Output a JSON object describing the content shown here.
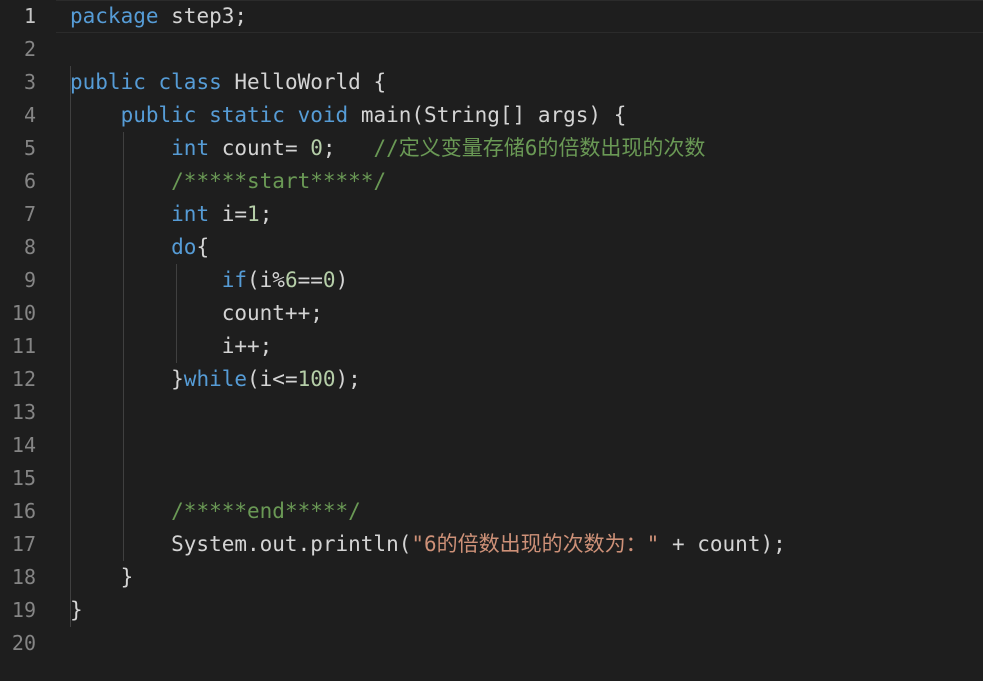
{
  "editor": {
    "line_numbers": [
      "1",
      "2",
      "3",
      "4",
      "5",
      "6",
      "7",
      "8",
      "9",
      "10",
      "11",
      "12",
      "13",
      "14",
      "15",
      "16",
      "17",
      "18",
      "19",
      "20"
    ],
    "lines": [
      [
        {
          "t": "kw",
          "s": "package"
        },
        {
          "t": "pl",
          "s": " step3;"
        }
      ],
      [],
      [
        {
          "t": "kw",
          "s": "public"
        },
        {
          "t": "pl",
          "s": " "
        },
        {
          "t": "kw",
          "s": "class"
        },
        {
          "t": "pl",
          "s": " HelloWorld {"
        }
      ],
      [
        {
          "t": "pl",
          "s": "    "
        },
        {
          "t": "kw",
          "s": "public"
        },
        {
          "t": "pl",
          "s": " "
        },
        {
          "t": "kw",
          "s": "static"
        },
        {
          "t": "pl",
          "s": " "
        },
        {
          "t": "kw",
          "s": "void"
        },
        {
          "t": "pl",
          "s": " main(String[] args) {"
        }
      ],
      [
        {
          "t": "pl",
          "s": "        "
        },
        {
          "t": "kw",
          "s": "int"
        },
        {
          "t": "pl",
          "s": " count= "
        },
        {
          "t": "num",
          "s": "0"
        },
        {
          "t": "pl",
          "s": ";   "
        },
        {
          "t": "cm",
          "s": "//定义变量存储6的倍数出现的次数"
        }
      ],
      [
        {
          "t": "pl",
          "s": "        "
        },
        {
          "t": "cm",
          "s": "/*****start*****/"
        }
      ],
      [
        {
          "t": "pl",
          "s": "        "
        },
        {
          "t": "kw",
          "s": "int"
        },
        {
          "t": "pl",
          "s": " i="
        },
        {
          "t": "num",
          "s": "1"
        },
        {
          "t": "pl",
          "s": ";"
        }
      ],
      [
        {
          "t": "pl",
          "s": "        "
        },
        {
          "t": "kw",
          "s": "do"
        },
        {
          "t": "pl",
          "s": "{"
        }
      ],
      [
        {
          "t": "pl",
          "s": "            "
        },
        {
          "t": "kw",
          "s": "if"
        },
        {
          "t": "pl",
          "s": "(i%"
        },
        {
          "t": "num",
          "s": "6"
        },
        {
          "t": "pl",
          "s": "=="
        },
        {
          "t": "num",
          "s": "0"
        },
        {
          "t": "pl",
          "s": ")"
        }
      ],
      [
        {
          "t": "pl",
          "s": "            count++;"
        }
      ],
      [
        {
          "t": "pl",
          "s": "            i++;"
        }
      ],
      [
        {
          "t": "pl",
          "s": "        }"
        },
        {
          "t": "kw",
          "s": "while"
        },
        {
          "t": "pl",
          "s": "(i<="
        },
        {
          "t": "num",
          "s": "100"
        },
        {
          "t": "pl",
          "s": ");"
        }
      ],
      [],
      [],
      [],
      [
        {
          "t": "pl",
          "s": "        "
        },
        {
          "t": "cm",
          "s": "/*****end*****/"
        }
      ],
      [
        {
          "t": "pl",
          "s": "        System.out.println("
        },
        {
          "t": "str",
          "s": "\"6的倍数出现的次数为：\""
        },
        {
          "t": "pl",
          "s": " + count);"
        }
      ],
      [
        {
          "t": "pl",
          "s": "    }"
        }
      ],
      [
        {
          "t": "pl",
          "s": "}"
        }
      ],
      []
    ]
  },
  "colors": {
    "background": "#1e1e1e",
    "keyword": "#569cd6",
    "comment": "#6a9955",
    "number": "#b5cea8",
    "string": "#ce9178",
    "text": "#d4d4d4",
    "line_number": "#858585"
  }
}
